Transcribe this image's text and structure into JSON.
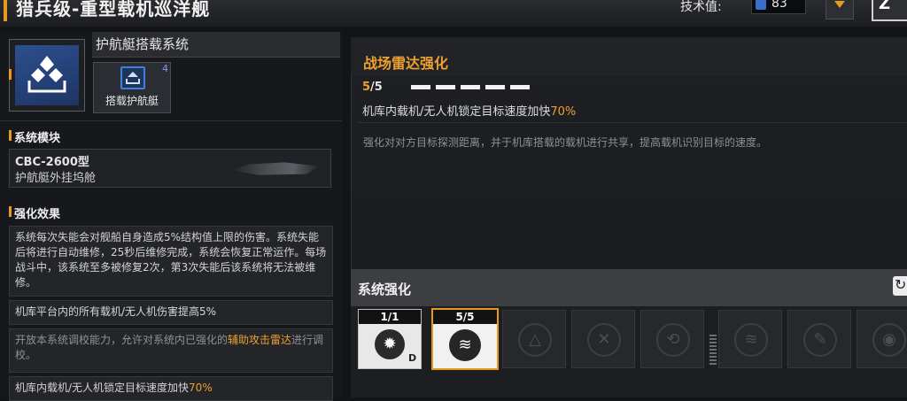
{
  "header": {
    "title": "猎兵级-重型载机巡洋舰",
    "tech_label": "技术值:",
    "tech_value": "83",
    "corner_glyph": "Z"
  },
  "left": {
    "system_name": "护航艇搭载系统",
    "carrier_label": "搭载护航艇",
    "carrier_count": "4",
    "module_section": "系统模块",
    "module_code": "CBC-2600型",
    "module_name": "护航艇外挂坞舱",
    "effect_section": "强化效果",
    "effects": [
      {
        "text": "系统每次失能会对舰船自身造成5%结构值上限的伤害。系统失能后将进行自动维修，25秒后维修完成，系统会恢复正常运作。每场战斗中，该系统至多被修复2次，第3次失能后该系统将无法被维修。"
      },
      {
        "text": "机库平台内的所有载机/无人机伤害提高5%"
      },
      {
        "text_pre": "开放本系统调校能力，允许对系统内已强化的",
        "text_hl": "辅助攻击雷达",
        "text_post": "进行调校。"
      },
      {
        "text_pre": "机库内载机/无人机锁定目标速度加快",
        "text_hl": "70%"
      }
    ]
  },
  "detail": {
    "title": "战场雷达强化",
    "level_current": "5",
    "level_max": "/5",
    "pips": 5,
    "line_pre": "机库内载机/无人机锁定目标速度加快",
    "line_hl": "70%",
    "description": "强化对对方目标探测距离，并于机库搭载的载机进行共享，提高载机识别目标的速度。"
  },
  "enhancement": {
    "title": "系统强化",
    "cards": [
      {
        "level": "1/1",
        "badge": "D"
      },
      {
        "level": "5/5"
      }
    ]
  },
  "colors": {
    "accent": "#e89a1f",
    "highlight": "#f0a030",
    "blue": "#3b6fc9"
  }
}
